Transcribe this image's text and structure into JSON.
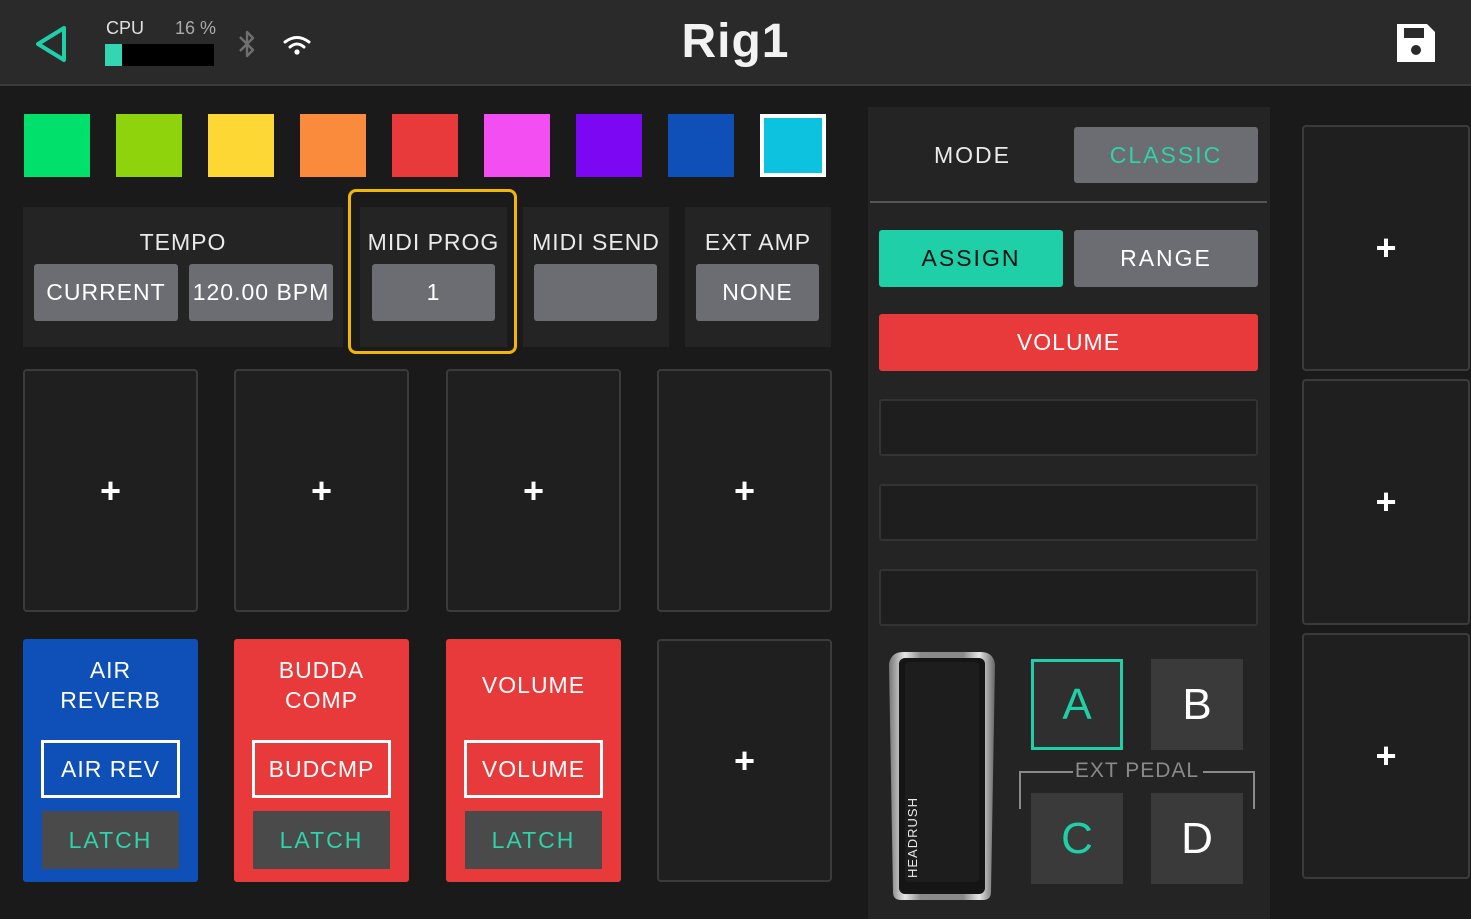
{
  "header": {
    "title": "Rig1",
    "cpu_label": "CPU",
    "cpu_percent_text": "16 %",
    "cpu_usage_fraction": 0.16
  },
  "swatches": [
    {
      "name": "green",
      "color": "#00e06a"
    },
    {
      "name": "lime",
      "color": "#8ed30b"
    },
    {
      "name": "yellow",
      "color": "#fdd835"
    },
    {
      "name": "orange",
      "color": "#fb8b3c"
    },
    {
      "name": "red",
      "color": "#e83a3a"
    },
    {
      "name": "pink",
      "color": "#f24ef2"
    },
    {
      "name": "purple",
      "color": "#7c07f2"
    },
    {
      "name": "blue",
      "color": "#0e4fb8"
    },
    {
      "name": "cyan",
      "color": "#0dc2df",
      "selected": true
    }
  ],
  "tempo": {
    "label": "TEMPO",
    "source": "CURRENT",
    "bpm": "120.00 BPM"
  },
  "midi_prog": {
    "label": "MIDI PROG",
    "value": "1"
  },
  "midi_send": {
    "label": "MIDI SEND",
    "value": ""
  },
  "ext_amp": {
    "label": "EXT AMP",
    "value": "NONE"
  },
  "slot_plus": "+",
  "footswitches": [
    {
      "name": "AIR",
      "name2": "REVERB",
      "tag": "AIR REV",
      "mode": "LATCH",
      "color": "#0e4fb8"
    },
    {
      "name": "BUDDA",
      "name2": "COMP",
      "tag": "BUDCMP",
      "mode": "LATCH",
      "color": "#e83a3a"
    },
    {
      "name": "VOLUME",
      "name2": "",
      "tag": "VOLUME",
      "mode": "LATCH",
      "color": "#e83a3a"
    }
  ],
  "control": {
    "mode_label": "MODE",
    "mode_value": "CLASSIC",
    "assign_label": "ASSIGN",
    "range_label": "RANGE",
    "assigned_param": "VOLUME",
    "pedal_brand": "HEADRUSH",
    "pedal_buttons": [
      "A",
      "B",
      "C",
      "D"
    ],
    "ext_pedal_label": "EXT PEDAL"
  },
  "colors": {
    "accent": "#1ecfa7",
    "highlight": "#f2b705"
  }
}
